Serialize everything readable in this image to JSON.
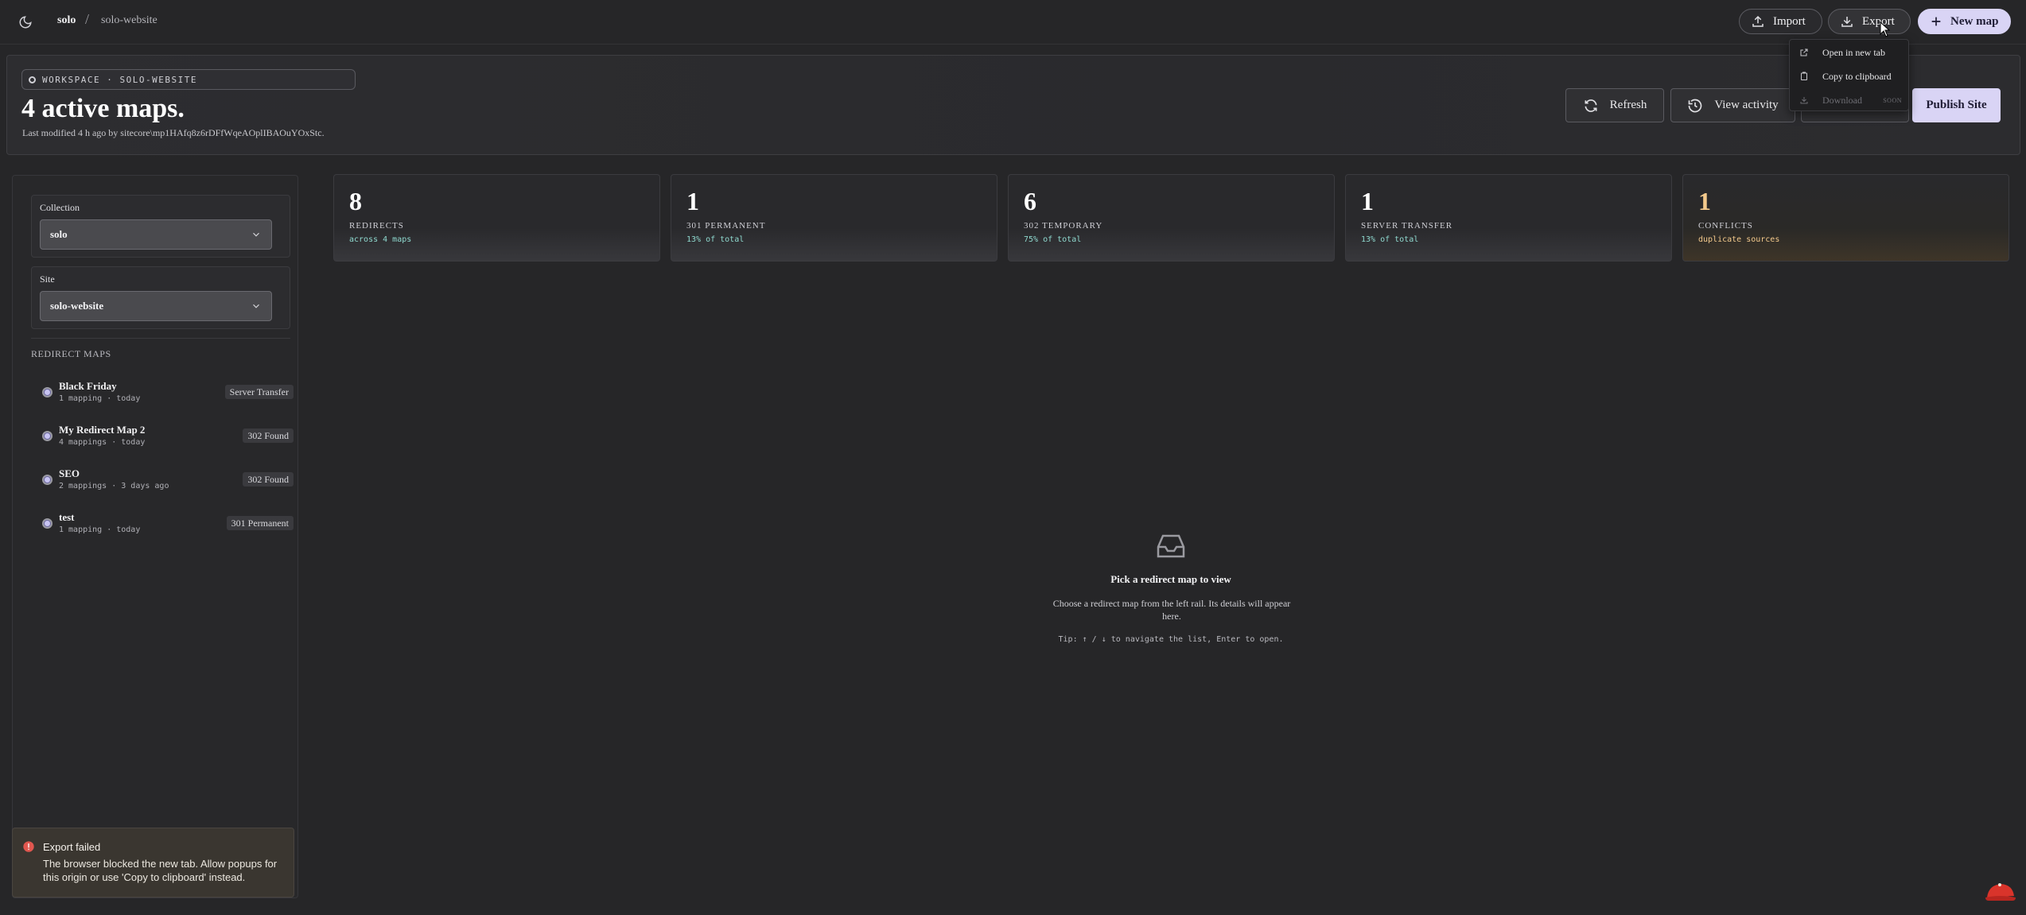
{
  "topbar": {
    "breadcrumb_root": "solo",
    "breadcrumb_sep": "/",
    "breadcrumb_leaf": "solo-website",
    "import_label": "Import",
    "export_label": "Export",
    "new_map_label": "New map"
  },
  "export_menu": {
    "items": [
      {
        "label": "Open in new tab",
        "icon": "external-link-icon"
      },
      {
        "label": "Copy to clipboard",
        "icon": "clipboard-icon"
      },
      {
        "label": "Download",
        "icon": "download-icon",
        "tag": "SOON",
        "disabled": true
      }
    ]
  },
  "header": {
    "workspace_pill": "WORKSPACE · SOLO-WEBSITE",
    "title": "4 active maps.",
    "subtitle": "Last modified 4 h ago by sitecore\\mp1HAfq8z6rDFfWqeAOplIBAOuYOxStc.",
    "refresh_label": "Refresh",
    "activity_label": "View activity",
    "publish_label": "Publish Site"
  },
  "sidebar": {
    "collection_label": "Collection",
    "collection_value": "solo",
    "site_label": "Site",
    "site_value": "solo-website",
    "rail_heading": "REDIRECT MAPS",
    "maps": [
      {
        "name": "Black Friday",
        "meta": "1 mapping · today",
        "badge": "Server Transfer"
      },
      {
        "name": "My Redirect Map 2",
        "meta": "4 mappings · today",
        "badge": "302 Found"
      },
      {
        "name": "SEO",
        "meta": "2 mappings · 3 days ago",
        "badge": "302 Found"
      },
      {
        "name": "test",
        "meta": "1 mapping · today",
        "badge": "301 Permanent"
      }
    ]
  },
  "stats": [
    {
      "value": "8",
      "label": "REDIRECTS",
      "note": "across 4 maps"
    },
    {
      "value": "1",
      "label": "301 PERMANENT",
      "note": "13% of total"
    },
    {
      "value": "6",
      "label": "302 TEMPORARY",
      "note": "75% of total"
    },
    {
      "value": "1",
      "label": "SERVER TRANSFER",
      "note": "13% of total"
    },
    {
      "value": "1",
      "label": "CONFLICTS",
      "note": "duplicate sources"
    }
  ],
  "empty_state": {
    "title": "Pick a redirect map to view",
    "description": "Choose a redirect map from the left rail. Its details will appear here.",
    "tip": "Tip: ↑ / ↓ to navigate the list, Enter to open."
  },
  "toast": {
    "title": "Export failed",
    "message": "The browser blocked the new tab. Allow popups for this origin or use 'Copy to clipboard' instead."
  },
  "colors": {
    "accent": "#d9d4f5",
    "teal_note": "#8fd9cf",
    "warning": "#f3c98c",
    "error": "#e0574f"
  }
}
